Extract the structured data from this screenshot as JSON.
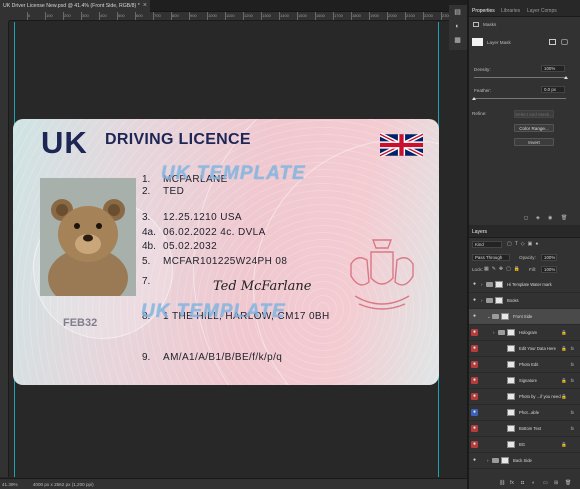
{
  "document": {
    "tab_title": "UK Driver License New.psd @ 41.4% (Front Side, RGB/8) *",
    "close_glyph": "×"
  },
  "rulers": {
    "labels": [
      "0",
      "100",
      "200",
      "300",
      "400",
      "500",
      "600",
      "700",
      "800",
      "900",
      "1000",
      "1100",
      "1200",
      "1300",
      "1400",
      "1500",
      "1600",
      "1700",
      "1800",
      "1900",
      "2000",
      "2100",
      "2200",
      "2300",
      "2400",
      "2500"
    ]
  },
  "licence": {
    "country": "UK",
    "title": "DRIVING LICENCE",
    "fields": [
      {
        "num": "1.",
        "value": "MCFARLANE"
      },
      {
        "num": "2.",
        "value": "TED"
      },
      {
        "num": "3.",
        "value": "12.25.1210 USA"
      },
      {
        "num": "4a.",
        "value": "06.02.2022  4c. DVLA"
      },
      {
        "num": "4b.",
        "value": "05.02.2032"
      },
      {
        "num": "5.",
        "value": "MCFAR101225W24PH 08"
      },
      {
        "num": "7.",
        "value": ""
      },
      {
        "num": "8.",
        "value": "1 THE HILL, HARLOW, CM17 0BH"
      },
      {
        "num": "9.",
        "value": "AM/A1/A/B1/B/BE/f/k/p/q"
      }
    ],
    "watermark_1": "UK TEMPLATE",
    "watermark_2": "UK TEMPLATE",
    "signature": "Ted McFarlane",
    "ghost_text": "FEB32"
  },
  "status_bar": {
    "zoom": "41.39%",
    "doc_size": "4000 px x 2562 px (1,200 ppi)"
  },
  "properties_panel": {
    "tabs": [
      "Properties",
      "Libraries",
      "Layer Comps"
    ],
    "active_tab": "Properties",
    "masks_label": "Masks",
    "layer_mask_label": "Layer Mask",
    "density_label": "Density:",
    "density_value": "100%",
    "density_fraction": 1.0,
    "feather_label": "Feather:",
    "feather_value": "0.0 px",
    "feather_fraction": 0.0,
    "refine_label": "Refine:",
    "select_mask_button": "Select and Mask...",
    "color_range_button": "Color Range...",
    "invert_button": "Invert"
  },
  "layers_panel": {
    "title": "Layers",
    "filter_kind": "Kind",
    "blend_mode": "Pass Through",
    "opacity_label": "Opacity:",
    "opacity_value": "100%",
    "lock_label": "Lock:",
    "fill_label": "Fill:",
    "fill_value": "100%",
    "layers": [
      {
        "name": "Hi Template Water mark",
        "eye": "none",
        "type": "folder",
        "indent": 0,
        "fx": false,
        "lock": false
      },
      {
        "name": "Books",
        "eye": "none",
        "type": "folder",
        "indent": 0,
        "fx": false,
        "lock": false
      },
      {
        "name": "Front Side",
        "eye": "none",
        "type": "folder",
        "indent": 1,
        "fx": false,
        "lock": false,
        "selected": true
      },
      {
        "name": "Hologram",
        "eye": "red",
        "type": "folder",
        "indent": 2,
        "fx": false,
        "lock": true
      },
      {
        "name": "Edit Your Data Here",
        "eye": "red",
        "type": "layer",
        "indent": 2,
        "fx": true,
        "lock": true
      },
      {
        "name": "Photo Edit",
        "eye": "red",
        "type": "layer",
        "indent": 2,
        "fx": true,
        "lock": false
      },
      {
        "name": "Signature",
        "eye": "red",
        "type": "layer",
        "indent": 2,
        "fx": true,
        "lock": true
      },
      {
        "name": "Photo by ...if you need",
        "eye": "red",
        "type": "layer",
        "indent": 2,
        "fx": false,
        "lock": true
      },
      {
        "name": "Phot...able",
        "eye": "blue",
        "type": "layer",
        "indent": 2,
        "fx": true,
        "lock": false
      },
      {
        "name": "Bottom Text",
        "eye": "red",
        "type": "layer",
        "indent": 2,
        "fx": true,
        "lock": false
      },
      {
        "name": "BG",
        "eye": "red",
        "type": "layer",
        "indent": 2,
        "fx": false,
        "lock": true
      },
      {
        "name": "Back Side",
        "eye": "none",
        "type": "folder",
        "indent": 1,
        "fx": false,
        "lock": false
      }
    ],
    "footer_icons": [
      "link-icon",
      "fx-icon",
      "mask-icon",
      "adjust-icon",
      "folder-icon",
      "new-layer-icon",
      "trash-icon"
    ],
    "fx_glyph": "fx",
    "lock_glyph": "🔒",
    "eye_glyph": "●"
  }
}
